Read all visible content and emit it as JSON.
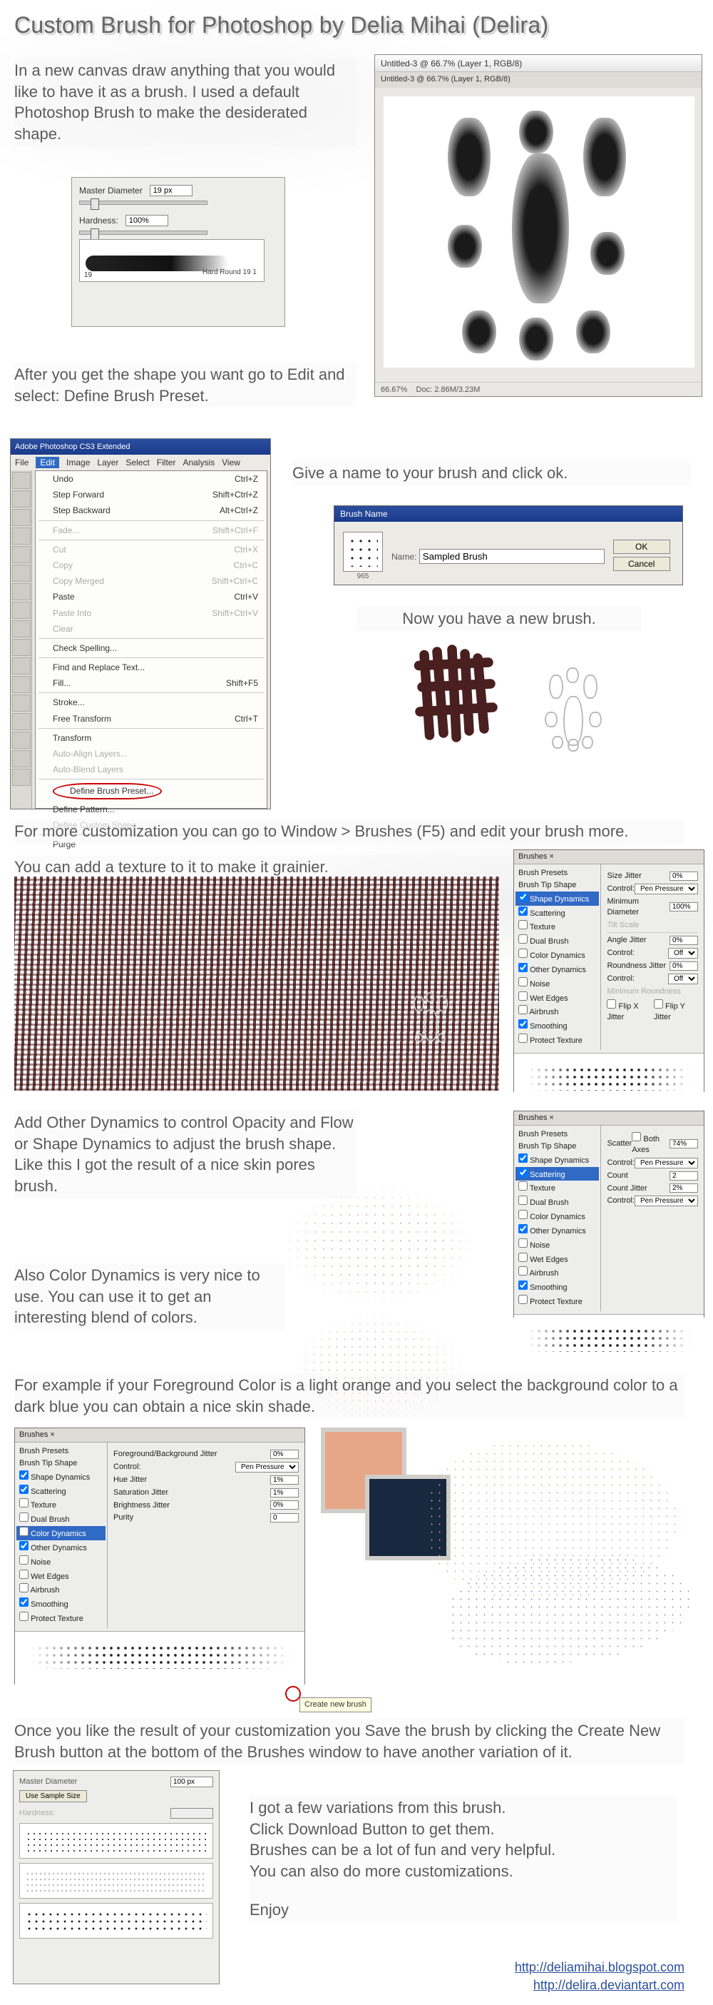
{
  "title": "Custom Brush for Photoshop by Delia Mihai (Delira)",
  "step1_text": "In a new canvas draw anything that you would like to have it as a brush. I used a default Photoshop Brush to make the desiderated shape.",
  "hardround": {
    "master_label": "Master Diameter",
    "master_val": "19 px",
    "hardness_label": "Hardness:",
    "hardness_val": "100%",
    "stroke_num": "19",
    "stroke_name": "Hard Round 19 1"
  },
  "step2_text": "After you get the shape you want go to Edit and select: Define Brush Preset.",
  "canvas_win": {
    "title": "Untitled-3 @ 66.7% (Layer 1, RGB/8)",
    "tab": "Untitled-3 @ 66.7% (Layer 1, RGB/8)",
    "status_zoom": "66.67%",
    "status_doc": "Doc: 2.86M/3.23M"
  },
  "menu": {
    "appbar": "Adobe Photoshop CS3 Extended",
    "menubar": [
      "File",
      "Edit",
      "Image",
      "Layer",
      "Select",
      "Filter",
      "Analysis",
      "View"
    ],
    "items": [
      {
        "l": "Undo",
        "sc": "Ctrl+Z",
        "d": false
      },
      {
        "l": "Step Forward",
        "sc": "Shift+Ctrl+Z",
        "d": false
      },
      {
        "l": "Step Backward",
        "sc": "Alt+Ctrl+Z",
        "d": false
      },
      {
        "l": "Fade...",
        "sc": "Shift+Ctrl+F",
        "d": true
      },
      {
        "l": "Cut",
        "sc": "Ctrl+X",
        "d": true
      },
      {
        "l": "Copy",
        "sc": "Ctrl+C",
        "d": true
      },
      {
        "l": "Copy Merged",
        "sc": "Shift+Ctrl+C",
        "d": true
      },
      {
        "l": "Paste",
        "sc": "Ctrl+V",
        "d": false
      },
      {
        "l": "Paste Into",
        "sc": "Shift+Ctrl+V",
        "d": true
      },
      {
        "l": "Clear",
        "sc": "",
        "d": true
      },
      {
        "l": "Check Spelling...",
        "sc": "",
        "d": false
      },
      {
        "l": "Find and Replace Text...",
        "sc": "",
        "d": false
      },
      {
        "l": "Fill...",
        "sc": "Shift+F5",
        "d": false
      },
      {
        "l": "Stroke...",
        "sc": "",
        "d": false
      },
      {
        "l": "Free Transform",
        "sc": "Ctrl+T",
        "d": false
      },
      {
        "l": "Transform",
        "sc": "",
        "d": false
      },
      {
        "l": "Auto-Align Layers...",
        "sc": "",
        "d": true
      },
      {
        "l": "Auto-Blend Layers",
        "sc": "",
        "d": true
      },
      {
        "l": "Define Brush Preset...",
        "sc": "",
        "d": false,
        "circled": true
      },
      {
        "l": "Define Pattern...",
        "sc": "",
        "d": false
      },
      {
        "l": "Define Custom Shape...",
        "sc": "",
        "d": true
      },
      {
        "l": "Purge",
        "sc": "",
        "d": false
      }
    ]
  },
  "step3_text": "Give a name to your brush and click ok.",
  "name_dlg": {
    "title": "Brush Name",
    "name_label": "Name:",
    "name_value": "Sampled Brush",
    "thumb_size": "965",
    "ok": "OK",
    "cancel": "Cancel"
  },
  "step4_text": "Now you have a new brush.",
  "step5_text": "For more customization you can go to Window > Brushes (F5) and edit your brush more.",
  "step6_text": "You can add a texture to it to make it grainier.",
  "brush_opts": [
    "Brush Presets",
    "Brush Tip Shape",
    "Shape Dynamics",
    "Scattering",
    "Texture",
    "Dual Brush",
    "Color Dynamics",
    "Other Dynamics",
    "Noise",
    "Wet Edges",
    "Airbrush",
    "Smoothing",
    "Protect Texture"
  ],
  "panel_shape": {
    "tab": "Brushes ×",
    "size_jitter": "Size Jitter",
    "size_jitter_v": "0%",
    "control": "Control:",
    "control_v": "Pen Pressure",
    "min_diam": "Minimum Diameter",
    "min_diam_v": "100%",
    "tilt": "Tilt Scale",
    "angle_jitter": "Angle Jitter",
    "angle_jitter_v": "0%",
    "control_off": "Off",
    "round_jitter": "Roundness Jitter",
    "round_jitter_v": "0%",
    "min_round": "Minimum Roundness",
    "flipx": "Flip X Jitter",
    "flipy": "Flip Y Jitter"
  },
  "step7_text": "Add Other Dynamics to control Opacity and Flow or Shape Dynamics to adjust the brush shape. Like this I got the result of a nice skin pores brush.",
  "panel_scatter": {
    "scatter": "Scatter",
    "both": "Both Axes",
    "scatter_v": "74%",
    "count": "Count",
    "count_v": "2",
    "count_jitter": "Count Jitter",
    "count_jitter_v": "2%"
  },
  "step8_text": "Also Color Dynamics is very nice to use. You can use it to get an interesting blend of colors.",
  "step9_text": "For example if your Foreground Color is a light orange and you select the background color to a dark blue you can obtain a nice skin shade.",
  "panel_color": {
    "fgbg": "Foreground/Background Jitter",
    "fgbg_v": "0%",
    "hue": "Hue Jitter",
    "hue_v": "1%",
    "sat": "Saturation Jitter",
    "sat_v": "1%",
    "bri": "Brightness Jitter",
    "bri_v": "0%",
    "purity": "Purity",
    "purity_v": "0"
  },
  "create_brush_tip": "Create new brush",
  "step10_text": "Once you like the result of your customization you Save the brush by clicking the Create New Brush button at the bottom of the Brushes window to have another variation of it.",
  "final": {
    "master_label": "Master Diameter",
    "master_v": "100 px",
    "use_sample": "Use Sample Size",
    "hardness_label": "Hardness:"
  },
  "closing1": "I got a few variations from this brush.",
  "closing2": "Click Download Button to get them.",
  "closing3": "Brushes can be a lot of fun and very helpful.",
  "closing4": "You can also do more customizations.",
  "closing5": "Enjoy",
  "link1": "http://deliamihai.blogspot.com",
  "link2": "http://delira.deviantart.com"
}
